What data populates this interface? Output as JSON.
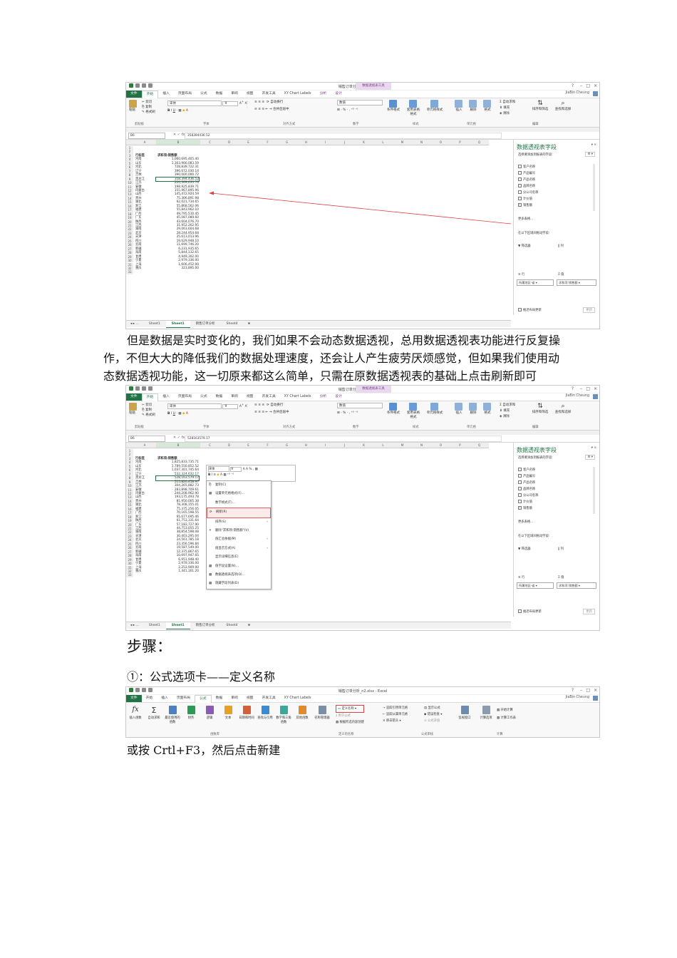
{
  "paragraphs": {
    "p1_line1": "但是数据是实时变化的，我们如果不会动态数据透视，总用数据透视表功能进行反复操",
    "p1_line2": "作，不但大大的降低我们的数据处理速度，还会让人产生疲劳厌烦感觉，但如果我们使用动",
    "p1_line3": "态数据透视功能，这一切原来都这么简单，只需在原数据透视表的基础上点击刷新即可",
    "steps_heading": "步骤：",
    "step1": "①：公式选项卡——定义名称",
    "step1_note": "或按 Crtl+F3，然后点击新建"
  },
  "excel": {
    "window_title": "销售订单分析_n2.xlsx - Excel",
    "context_tab_group": "数据透视表工具",
    "user_name": "JiaBin Cheung",
    "tabs": [
      "文件",
      "开始",
      "插入",
      "页面布局",
      "公式",
      "数据",
      "审阅",
      "视图",
      "开发工具",
      "XY Chart Labels",
      "分析",
      "设计"
    ],
    "home_ribbon": {
      "cut": "剪切",
      "copy": "复制",
      "format_painter": "格式刷",
      "paste": "粘贴",
      "font_name": "宋体",
      "font_size": "9",
      "wrap_text": "自动换行",
      "merge_center": "合并后居中",
      "number_format": "数值",
      "conditional_format": "条件格式",
      "table_format": "套用表格格式",
      "cell_styles": "单元格样式",
      "insert": "插入",
      "delete": "删除",
      "format": "格式",
      "autosum": "自动求和",
      "fill": "填充",
      "clear": "清除",
      "sort_filter": "排序和筛选",
      "find_select": "查找和选择",
      "group_clipboard": "剪贴板",
      "group_font": "字体",
      "group_alignment": "对齐方式",
      "group_number": "数字",
      "group_styles": "样式",
      "group_cells": "单元格",
      "group_editing": "编辑"
    },
    "formula_ribbon": {
      "insert_function": "插入函数",
      "autosum": "自动求和",
      "recent": "最近使用的函数",
      "financial": "财务",
      "logical": "逻辑",
      "text": "文本",
      "datetime": "日期和时间",
      "lookup": "查找与引用",
      "math": "数学和三角函数",
      "more": "其他函数",
      "name_manager": "名称管理器",
      "define_name": "定义名称",
      "use_in_formula": "用于公式",
      "create_from_selection": "根据所选内容创建",
      "trace_precedents": "追踪引用单元格",
      "trace_dependents": "追踪从属单元格",
      "remove_arrows": "移去箭头",
      "show_formulas": "显示公式",
      "error_checking": "错误检查",
      "evaluate": "公式求值",
      "watch_window": "监视窗口",
      "calc_options": "计算选项",
      "calc_now": "开始计算",
      "calc_sheet": "计算工作表",
      "group_library": "函数库",
      "group_names": "定义的名称",
      "group_audit": "公式审核",
      "group_calc": "计算"
    },
    "name_box": "B6",
    "formula_values": [
      "358394436.52",
      "528163579.17"
    ],
    "col_headers": [
      "A",
      "B",
      "C",
      "D",
      "E",
      "F",
      "G",
      "H",
      "I",
      "J",
      "K",
      "L",
      "M",
      "N",
      "O",
      "P",
      "Q"
    ],
    "pivot_header": [
      "行标签",
      "求和项:销售额"
    ],
    "table1": [
      [
        "河南",
        "1,060,695,405.40"
      ],
      [
        "山东",
        "1,303,966,083.59"
      ],
      [
        "河北",
        "728,839,722.31"
      ],
      [
        "辽宁",
        "396,672,030.14"
      ],
      [
        "吉林",
        "390,000,000.72"
      ],
      [
        "黑龙江",
        "358,394,436.52"
      ],
      [
        "江苏",
        "220,569,635.70"
      ],
      [
        "安徽",
        "198,925,839.71"
      ],
      [
        "内蒙古",
        "155,967,895.96"
      ],
      [
        "山西",
        "145,472,924.59"
      ],
      [
        "贵州",
        "75,306,891.98"
      ],
      [
        "湖北",
        "62,021,734.65"
      ],
      [
        "浙江",
        "55,868,562.06"
      ],
      [
        "福建",
        "55,843,962.10"
      ],
      [
        "广西",
        "49,795,510.45"
      ],
      [
        "广东",
        "45,087,089.60"
      ],
      [
        "陕西",
        "43,604,076.70"
      ],
      [
        "江西",
        "31,952,262.95"
      ],
      [
        "湖南",
        "29,063,604.68"
      ],
      [
        "北京",
        "28,244,954.68"
      ],
      [
        "天津",
        "25,613,013.96"
      ],
      [
        "四川",
        "19,629,948.10"
      ],
      [
        "云南",
        "11,699,746.20"
      ],
      [
        "新疆",
        "6,231,935.65"
      ],
      [
        "海南",
        "5,844,132.65"
      ],
      [
        "甘肃",
        "4,949,302.00"
      ],
      [
        "宁夏",
        "2,979,336.00"
      ],
      [
        "上海",
        "1,606,452.00"
      ],
      [
        "重庆",
        "323,895.00"
      ]
    ],
    "table2": [
      [
        "河南",
        "1,825,833,735.71"
      ],
      [
        "山东",
        "1,789,550,852.52"
      ],
      [
        "河北",
        "1,037,301,745.64"
      ],
      [
        "辽宁",
        "532,324,632.17"
      ],
      [
        "黑龙江",
        "528,163,579.17"
      ],
      [
        "吉林",
        "515,820,458.97"
      ],
      [
        "江苏",
        "304,265,882.73"
      ],
      [
        "安徽",
        "283,898,709.61"
      ],
      [
        "内蒙古",
        "244,208,962.90"
      ],
      [
        "山西",
        "193,175,493.78"
      ],
      [
        "贵州",
        "81,950,005.38"
      ],
      [
        "湖北",
        "78,308,155.01"
      ],
      [
        "福建",
        "75,375,256.05"
      ],
      [
        "广西",
        "70,165,598.55"
      ],
      [
        "浙江",
        "65,677,695.46"
      ],
      [
        "陕西",
        "61,753,331.64"
      ],
      [
        "广东",
        "57,183,727.90"
      ],
      [
        "江西",
        "44,753,055.25"
      ],
      [
        "湖南",
        "38,854,598.08"
      ],
      [
        "天津",
        "30,403,295.04"
      ],
      [
        "北京",
        "24,561,785.18"
      ],
      [
        "四川",
        "23,356,596.84"
      ],
      [
        "云南",
        "19,587,549.00"
      ],
      [
        "新疆",
        "12,375,867.65"
      ],
      [
        "海南",
        "10,697,947.65"
      ],
      [
        "甘肃",
        "6,951,948.40"
      ],
      [
        "宁夏",
        "2,979,336.00"
      ],
      [
        "上海",
        "2,253,909.00"
      ],
      [
        "重庆",
        "1,441,161.20"
      ]
    ],
    "sheet_tabs": [
      "Sheet1",
      "Sheet1",
      "销售订单分析",
      "Sheet4"
    ],
    "pivot_pane": {
      "title": "数据透视表字段",
      "subtitle": "选择要添加到报表的字段:",
      "fields": [
        "客户名称",
        "产品编号",
        "产品名称",
        "品牌名称",
        "分公司名称",
        "计价值",
        "销售额"
      ],
      "more": "更多表格...",
      "drag_hint": "在以下区域间拖动字段:",
      "filter": "筛选器",
      "columns": "列",
      "rows": "行",
      "values": "值",
      "row_value": "所属地区-省",
      "value_value": "求和项:销售额",
      "defer": "推迟布局更新",
      "update": "更新"
    },
    "context_menu": [
      "复制(C)",
      "设置单元格格式(F)...",
      "数字格式(T)...",
      "刷新(R)",
      "排序(S)",
      "删除\"求和项:销售额\"(V)",
      "值汇总依据(M)",
      "值显示方式(A)",
      "显示详细信息(E)",
      "值字段设置(N)...",
      "数据透视表选项(O)...",
      "隐藏字段列表(D)"
    ],
    "mini_toolbar": {
      "font": "宋体",
      "size": "9"
    }
  }
}
